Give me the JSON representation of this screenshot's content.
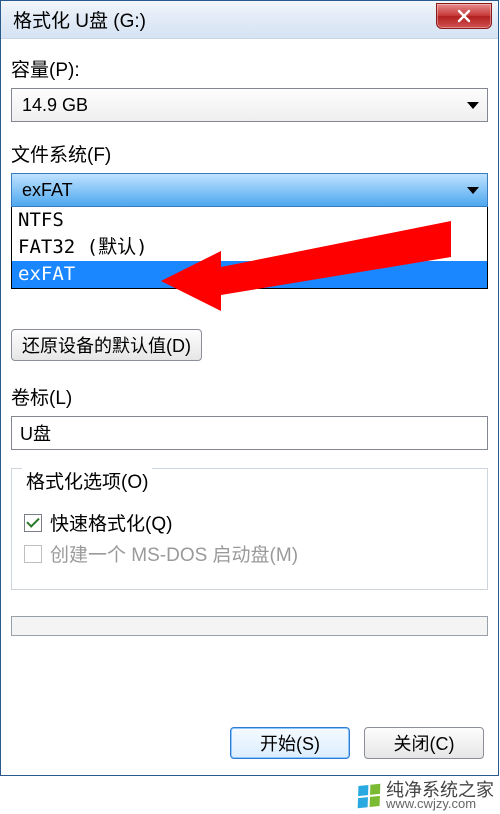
{
  "window": {
    "title": "格式化 U盘 (G:)"
  },
  "capacity": {
    "label": "容量(P):",
    "value": "14.9 GB"
  },
  "filesystem": {
    "label": "文件系统(F)",
    "value": "exFAT",
    "options": [
      {
        "text": "NTFS",
        "selected": false
      },
      {
        "text": "FAT32 (默认)",
        "selected": false
      },
      {
        "text": "exFAT",
        "selected": true
      }
    ]
  },
  "restore_defaults": {
    "label": "还原设备的默认值(D)"
  },
  "volume_label": {
    "label": "卷标(L)",
    "value": "U盘"
  },
  "format_options": {
    "legend": "格式化选项(O)",
    "quick_format": {
      "label": "快速格式化(Q)",
      "checked": true
    },
    "msdos_boot": {
      "label": "创建一个 MS-DOS 启动盘(M)",
      "checked": false,
      "disabled": true
    }
  },
  "progress": {
    "value": 0
  },
  "footer": {
    "start": "开始(S)",
    "close": "关闭(C)"
  },
  "watermark": {
    "name": "纯净系统之家",
    "url": "www.cwjzy.com"
  }
}
